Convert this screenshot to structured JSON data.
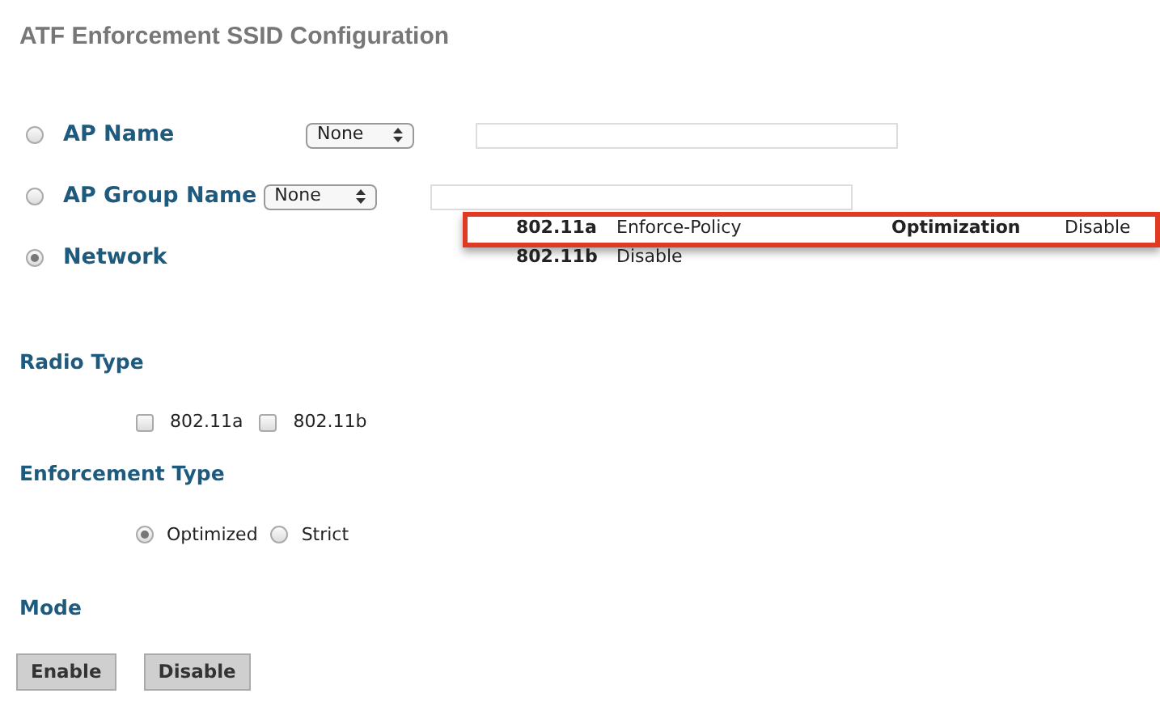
{
  "title": "ATF Enforcement SSID Configuration",
  "scope_options": [
    {
      "kind": "select-input",
      "label": "AP Name",
      "selected": false,
      "select_value": "None"
    },
    {
      "kind": "select-input",
      "label": "AP Group Name",
      "selected": false,
      "select_value": "None"
    },
    {
      "kind": "plain",
      "label": "Network",
      "selected": true
    }
  ],
  "network_popup": {
    "rows": [
      {
        "radio": "802.11a",
        "policy": "Enforce-Policy",
        "extra_label": "Optimization",
        "extra_value": "Disable",
        "highlighted": true
      },
      {
        "radio": "802.11b",
        "policy": "Disable",
        "highlighted": false
      }
    ]
  },
  "radio_type": {
    "heading": "Radio Type",
    "options": [
      {
        "label": "802.11a",
        "checked": false
      },
      {
        "label": "802.11b",
        "checked": false
      }
    ]
  },
  "enforcement_type": {
    "heading": "Enforcement Type",
    "options": [
      {
        "label": "Optimized",
        "selected": true
      },
      {
        "label": "Strict",
        "selected": false
      }
    ]
  },
  "mode": {
    "heading": "Mode",
    "buttons": [
      "Enable",
      "Disable"
    ]
  }
}
